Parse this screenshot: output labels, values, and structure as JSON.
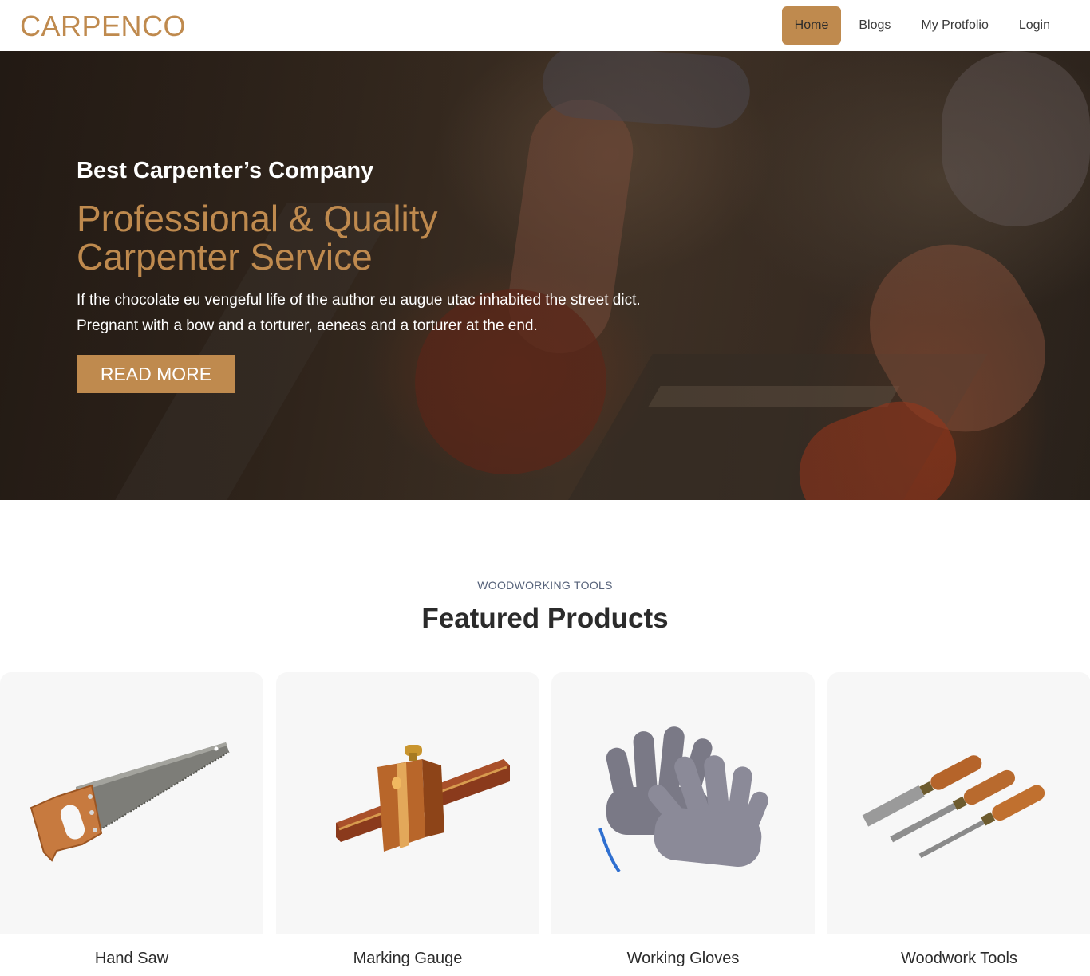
{
  "brand": {
    "logo": "CARPENCO",
    "accent_color": "#bf8a4e"
  },
  "nav": {
    "items": [
      {
        "label": "Home",
        "active": true
      },
      {
        "label": "Blogs",
        "active": false
      },
      {
        "label": "My Protfolio",
        "active": false
      },
      {
        "label": "Login",
        "active": false
      }
    ]
  },
  "hero": {
    "kicker": "Best Carpenter’s Company",
    "title": "Professional & Quality Carpenter Service",
    "text_line1": "If the chocolate eu vengeful life of the author eu augue utac inhabited the street dict.",
    "text_line2": "Pregnant with a bow and a torturer, aeneas and a torturer at the end.",
    "button_label": "READ MORE"
  },
  "featured": {
    "kicker": "WOODWORKING TOOLS",
    "title": "Featured Products",
    "products": [
      {
        "name": "Hand Saw",
        "icon": "hand-saw-image"
      },
      {
        "name": "Marking Gauge",
        "icon": "marking-gauge-image"
      },
      {
        "name": "Working Gloves",
        "icon": "working-gloves-image"
      },
      {
        "name": "Woodwork Tools",
        "icon": "chisels-image"
      }
    ]
  }
}
